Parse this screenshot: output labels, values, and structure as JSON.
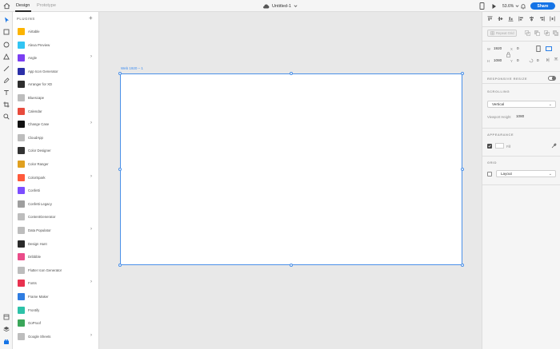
{
  "header": {
    "tabs": [
      {
        "label": "Design",
        "active": true
      },
      {
        "label": "Prototype",
        "active": false
      }
    ],
    "document_title": "Untitled-1",
    "zoom": "53.6%",
    "share_label": "Share"
  },
  "plugins_panel": {
    "title": "PLUGINS",
    "add_symbol": "+",
    "items": [
      {
        "name": "Airtable",
        "color": "#fcb400",
        "submenu": false
      },
      {
        "name": "Alexa Preview",
        "color": "#31c4f3",
        "submenu": false
      },
      {
        "name": "Angle",
        "color": "#7b3ff2",
        "submenu": true
      },
      {
        "name": "App Icon Generator",
        "color": "#2b2fa8",
        "submenu": false
      },
      {
        "name": "Arranger for XD",
        "color": "#2d2d2d",
        "submenu": false
      },
      {
        "name": "Bluescape",
        "color": "#bdbdbd",
        "submenu": false
      },
      {
        "name": "Calendar",
        "color": "#e84b3c",
        "submenu": false
      },
      {
        "name": "Change Case",
        "color": "#111111",
        "submenu": true
      },
      {
        "name": "CloudApp",
        "color": "#bdbdbd",
        "submenu": false
      },
      {
        "name": "Color Designer",
        "color": "#333333",
        "submenu": false
      },
      {
        "name": "Color Ranger",
        "color": "#e0a020",
        "submenu": false
      },
      {
        "name": "ColorSpark",
        "color": "#ff5a3c",
        "submenu": true
      },
      {
        "name": "Confetti",
        "color": "#7c4dff",
        "submenu": false
      },
      {
        "name": "Confetti Legacy",
        "color": "#9e9e9e",
        "submenu": false
      },
      {
        "name": "ContentGenerator",
        "color": "#bdbdbd",
        "submenu": false
      },
      {
        "name": "Data Populator",
        "color": "#bdbdbd",
        "submenu": true
      },
      {
        "name": "Design Hunt",
        "color": "#2a2a2a",
        "submenu": false
      },
      {
        "name": "Dribbble",
        "color": "#ea4c89",
        "submenu": false
      },
      {
        "name": "Flutter Icon Generator",
        "color": "#bdbdbd",
        "submenu": false
      },
      {
        "name": "Fonts",
        "color": "#e8314f",
        "submenu": true
      },
      {
        "name": "Frame Maker",
        "color": "#2f7de1",
        "submenu": false
      },
      {
        "name": "Frontify",
        "color": "#2dc2a8",
        "submenu": false
      },
      {
        "name": "GoProof",
        "color": "#3aa65a",
        "submenu": false
      },
      {
        "name": "Google Sheets",
        "color": "#bdbdbd",
        "submenu": true
      }
    ]
  },
  "canvas": {
    "artboard_label": "Web 1920 – 1"
  },
  "inspector": {
    "repeat_grid_label": "Repeat Grid",
    "width_label": "W",
    "width_value": "1920",
    "height_label": "H",
    "height_value": "1080",
    "x_label": "X",
    "x_value": "0",
    "y_label": "Y",
    "y_value": "0",
    "rotation_value": "0",
    "responsive_resize_label": "RESPONSIVE RESIZE",
    "scrolling_label": "SCROLLING",
    "scrolling_value": "Vertical",
    "viewport_label": "Viewport Height",
    "viewport_value": "1080",
    "appearance_label": "APPEARANCE",
    "fill_label": "Fill",
    "grid_label": "GRID",
    "grid_value": "Layout"
  }
}
